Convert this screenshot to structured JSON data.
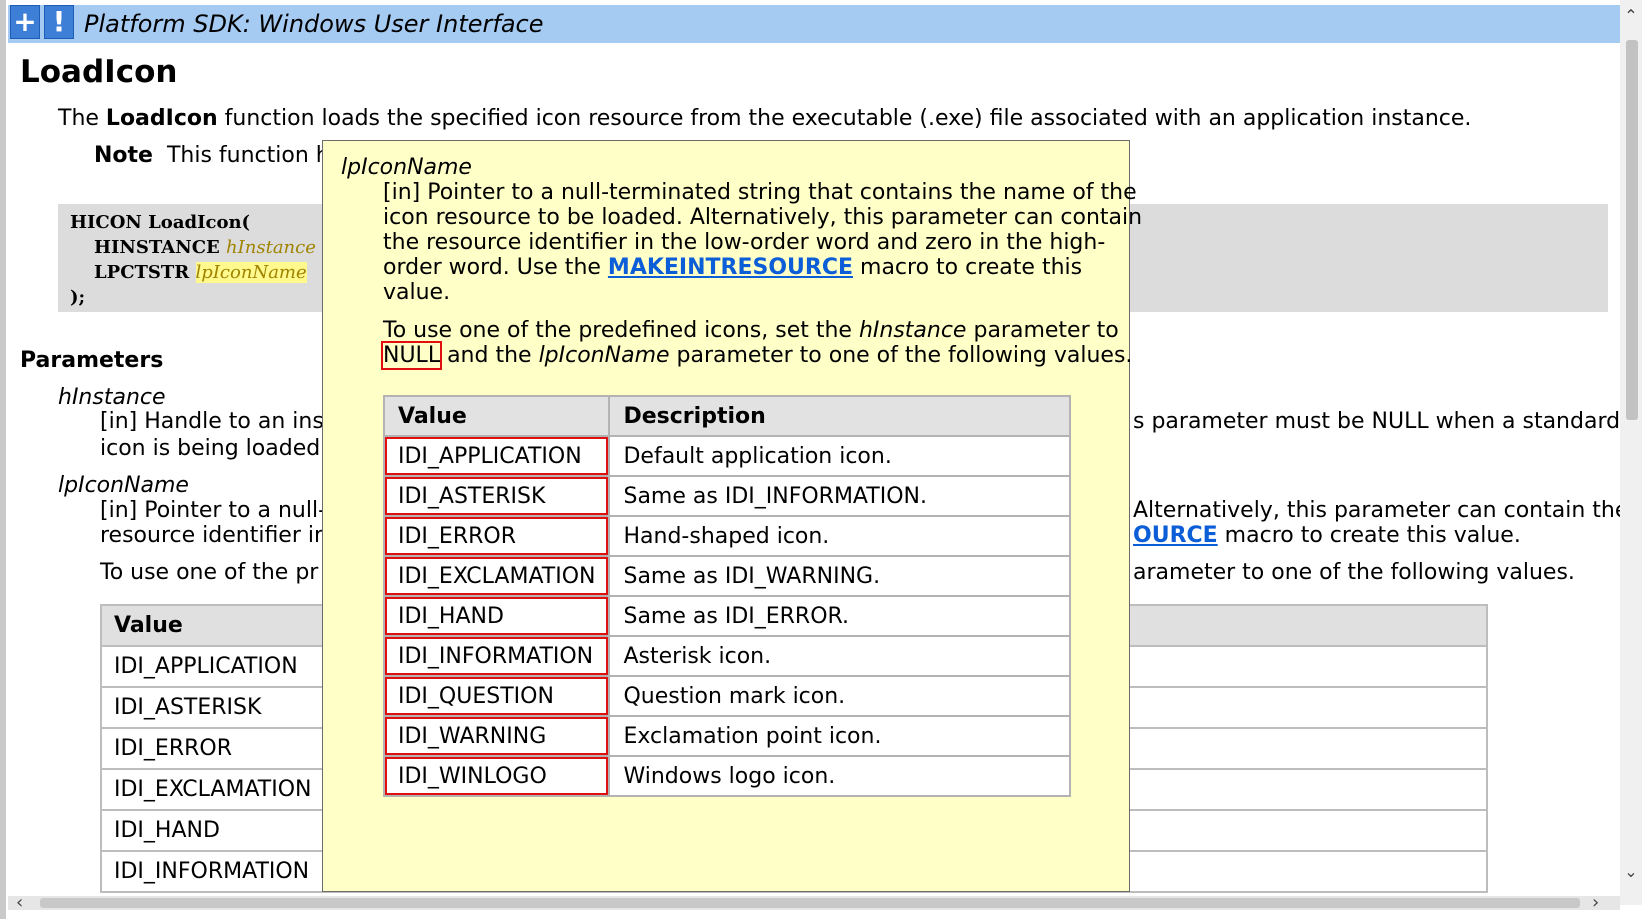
{
  "header": {
    "expand_button": "+",
    "alert_button": "!",
    "title": "Platform SDK: Windows User Interface"
  },
  "doc": {
    "title": "LoadIcon",
    "intro_prefix": "The ",
    "intro_bold": "LoadIcon",
    "intro_suffix": " function loads the specified icon resource from the executable (.exe) file associated with an application instance.",
    "note_label": "Note",
    "note_text": "This function h",
    "code": {
      "line1": "HICON LoadIcon(",
      "line2_type": "HINSTANCE",
      "line2_param": "hInstance",
      "line3_type": "LPCTSTR",
      "line3_param": "lpIconName",
      "line4": ");"
    },
    "parameters_heading": "Parameters",
    "param1_name": "hInstance",
    "param1_line1_left": "[in] Handle to an inst",
    "param1_line1_right": "s parameter must be NULL when a standard",
    "param1_line2": "icon is being loaded.",
    "param2_name": "lpIconName",
    "param2_line1_left": "[in] Pointer to a null-",
    "param2_line1_right": "Alternatively, this parameter can contain the",
    "param2_line2_left": "resource identifier in",
    "param2_line2_link": "OURCE",
    "param2_line2_right": " macro to create this value.",
    "param2_line3_left": "To use one of the pr",
    "param2_line3_right": "arameter to one of the following values.",
    "table_header": "Value",
    "table_rows": [
      "IDI_APPLICATION",
      "IDI_ASTERISK",
      "IDI_ERROR",
      "IDI_EXCLAMATION",
      "IDI_HAND",
      "IDI_INFORMATION"
    ]
  },
  "tooltip": {
    "param_name": "lpIconName",
    "line1": "[in] Pointer to a null-terminated string that contains the name of the",
    "line2": "icon resource to be loaded. Alternatively, this parameter can contain",
    "line3": "the resource identifier in the low-order word and zero in the high-",
    "line4_prefix": "order word. Use the ",
    "line4_link": "MAKEINTRESOURCE",
    "line4_suffix": " macro to create this",
    "line5": "value.",
    "p2_line1_prefix": "To use one of the predefined icons, set the ",
    "p2_line1_param": "hInstance",
    "p2_line1_suffix": " parameter to",
    "p2_null": "NULL",
    "p2_line2_mid": " and the ",
    "p2_line2_param": "lpIconName",
    "p2_line2_suffix": " parameter to one of the following values.",
    "table_headers": {
      "value": "Value",
      "description": "Description"
    },
    "table_rows": [
      {
        "value": "IDI_APPLICATION",
        "description": "Default application icon."
      },
      {
        "value": "IDI_ASTERISK",
        "description": "Same as IDI_INFORMATION."
      },
      {
        "value": "IDI_ERROR",
        "description": "Hand-shaped icon."
      },
      {
        "value": "IDI_EXCLAMATION",
        "description": "Same as IDI_WARNING."
      },
      {
        "value": "IDI_HAND",
        "description": "Same as IDI_ERROR."
      },
      {
        "value": "IDI_INFORMATION",
        "description": "Asterisk icon."
      },
      {
        "value": "IDI_QUESTION",
        "description": "Question mark icon."
      },
      {
        "value": "IDI_WARNING",
        "description": "Exclamation point icon."
      },
      {
        "value": "IDI_WINLOGO",
        "description": "Windows logo icon."
      }
    ]
  },
  "scrollbars": {
    "up_icon": "chevron-up-icon",
    "down_icon": "chevron-down-icon",
    "left_icon": "chevron-left-icon",
    "right_icon": "chevron-right-icon"
  },
  "colors": {
    "header_bg": "#a6cbf2",
    "button_bg": "#3d7fd6",
    "tooltip_bg": "#ffffc8",
    "link": "#0b5ed7",
    "highlight_box": "#e01010"
  }
}
